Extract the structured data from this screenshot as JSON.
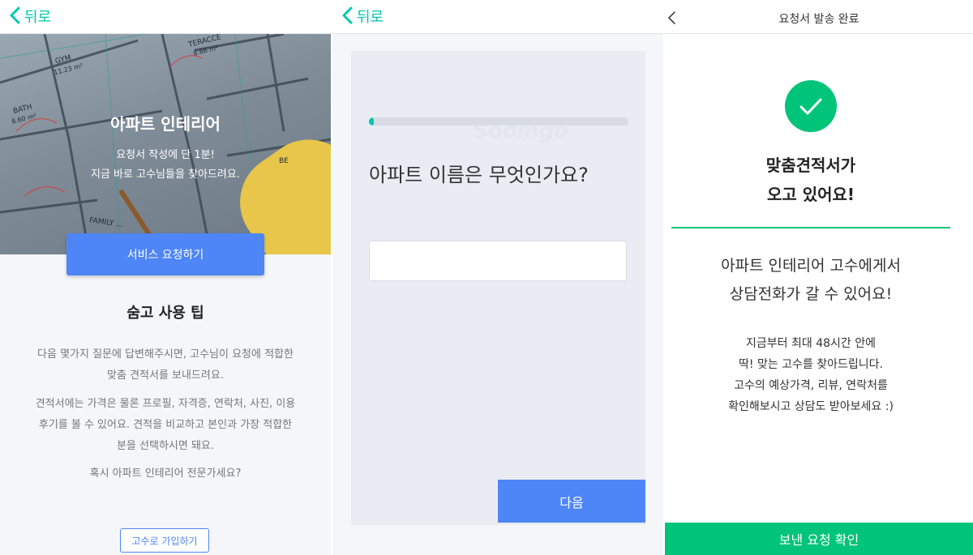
{
  "screen1": {
    "back_label": "뒤로",
    "hero": {
      "title": "아파트 인테리어",
      "subtitle_line1": "요청서 작성에 단 1분!",
      "subtitle_line2": "지금 바로 고수님들을 찾아드려요.",
      "blueprint_labels": [
        "GYM",
        "11.23 m²",
        "TERACCE",
        "8.66 m²",
        "BATH",
        "8.60 m²",
        "BE",
        "FAMILY ..."
      ]
    },
    "cta_label": "서비스 요청하기",
    "tips_title": "숨고 사용 팁",
    "tip1": [
      "다음 몇가지 질문에 답변해주시면, 고수님이 요청에 적합한",
      "맞춤 견적서를 보내드려요."
    ],
    "tip2": [
      "견적서에는 가격은 물론 프로필, 자격증, 연락처, 사진, 이용",
      "후기를 볼 수 있어요. 견적을 비교하고 본인과 가장 적합한",
      "분을 선택하시면 돼요."
    ],
    "tip3": "혹시 아파트 인테리어 전문가세요?",
    "join_label": "고수로 가입하기"
  },
  "screen2": {
    "back_label": "뒤로",
    "watermark": "Soomgo",
    "progress_fraction": 0.02,
    "question": "아파트 이름은 무엇인가요?",
    "answer_value": "",
    "next_label": "다음"
  },
  "screen3": {
    "title": "요청서 발송 완료",
    "headline_line1": "맞춤견적서가",
    "headline_line2": "오고 있어요!",
    "message_line1": "아파트 인테리어 고수에게서",
    "message_line2": "상담전화가 갈 수 있어요!",
    "detail": [
      "지금부터 최대 48시간 안에",
      "딱! 맞는 고수를 찾아드립니다.",
      "고수의 예상가격, 리뷰, 연락처를",
      "확인해보시고 상담도 받아보세요 :)"
    ],
    "bottom_label": "보낸 요청 확인"
  },
  "colors": {
    "accent_green": "#00c47a",
    "back_green": "#00c7ae",
    "primary_blue": "#4f86f7",
    "panel_bg": "#f4f6fa"
  }
}
